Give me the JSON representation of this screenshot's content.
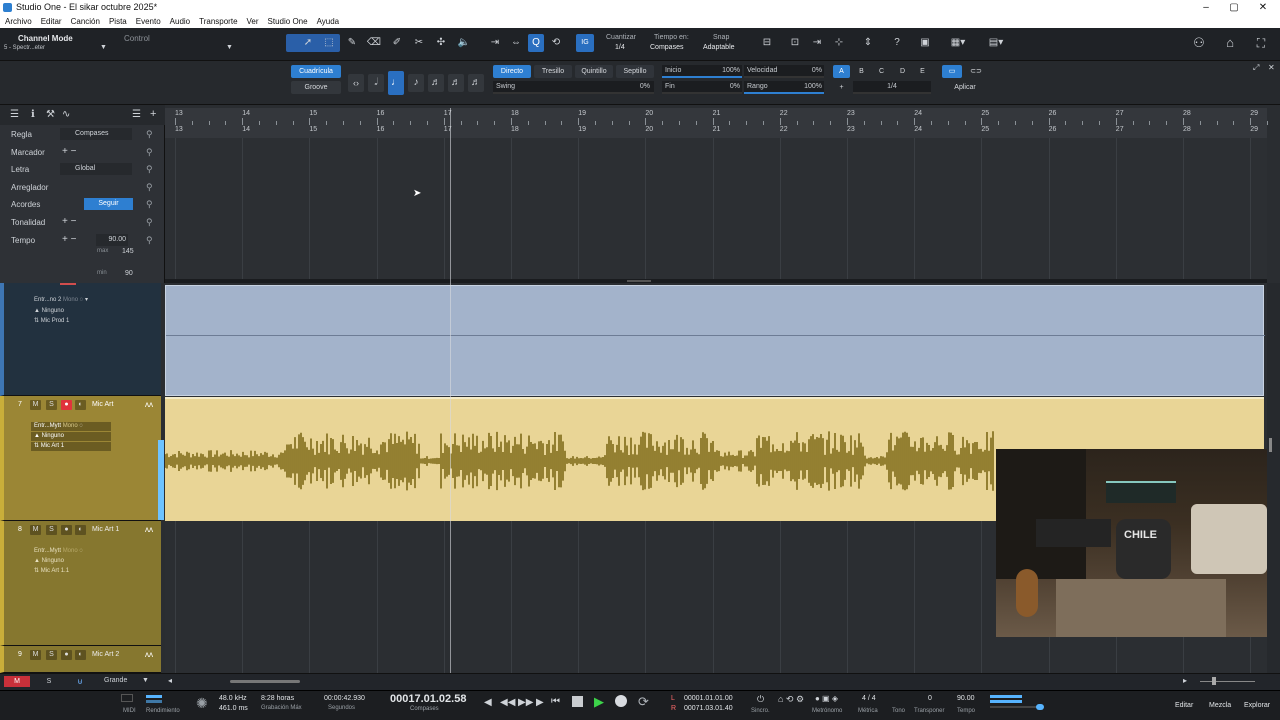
{
  "window": {
    "title": "Studio One - El sikar octubre 2025*",
    "min": "–",
    "max": "▢",
    "close": "✕"
  },
  "menu": [
    "Archivo",
    "Editar",
    "Canción",
    "Pista",
    "Evento",
    "Audio",
    "Transporte",
    "Ver",
    "Studio One",
    "Ayuda"
  ],
  "toolbar": {
    "mode": "Channel Mode",
    "preset": "5 - Spectr...eter",
    "control": "Control",
    "quantize_label": "Cuantizar",
    "quantize_value": "1/4",
    "timebase_label": "Tiempo en:",
    "timebase_value": "Compases",
    "snap_label": "Snap",
    "snap_value": "Adaptable",
    "ig": "IG",
    "help": "?"
  },
  "inspector": {
    "grid_tab": "Cuadrícula",
    "groove_tab": "Groove",
    "modes": [
      "Directo",
      "Tresillo",
      "Quintillo",
      "Septillo"
    ],
    "swing_label": "Swing",
    "swing_value": "0%",
    "inicio_label": "Inicio",
    "inicio_value": "100%",
    "fin_label": "Fin",
    "fin_value": "0%",
    "velocidad_label": "Velocidad",
    "velocidad_value": "0%",
    "rango_label": "Rango",
    "rango_value": "100%",
    "slots": [
      "A",
      "B",
      "C",
      "D",
      "E"
    ],
    "plus": "+",
    "note_value": "1/4",
    "apply": "Aplicar"
  },
  "global_tracks": [
    {
      "name": "Regla",
      "control": "Compases"
    },
    {
      "name": "Marcador",
      "control": "+ −"
    },
    {
      "name": "Letra",
      "control": "Global"
    },
    {
      "name": "Arreglador",
      "control": ""
    },
    {
      "name": "Acordes",
      "control": "Seguir"
    },
    {
      "name": "Tonalidad",
      "control": "+ −"
    },
    {
      "name": "Tempo",
      "control": "+ −",
      "value": "90.00"
    }
  ],
  "tempo_range": {
    "max_label": "max",
    "max": "145",
    "min_label": "min",
    "min": "90"
  },
  "ruler_bars": [
    "13",
    "14",
    "15",
    "16",
    "17",
    "18",
    "19",
    "20",
    "21",
    "22",
    "23",
    "24",
    "25",
    "26",
    "27",
    "28",
    "29"
  ],
  "tracks": [
    {
      "num": "",
      "name": "",
      "input": "Entr...no 2",
      "mono": "Mono",
      "route": "Ninguno",
      "output": "Mic Prod 1"
    },
    {
      "num": "7",
      "name": "Mic Art",
      "input": "Entr...Mytt",
      "mono": "Mono",
      "route": "Ninguno",
      "output": "Mic Art 1"
    },
    {
      "num": "8",
      "name": "Mic Art 1",
      "input": "Entr...Mytt",
      "mono": "Mono",
      "route": "Ninguno",
      "output": "Mic Art 1.1"
    },
    {
      "num": "9",
      "name": "Mic Art 2"
    }
  ],
  "track_buttons": {
    "mute": "M",
    "solo": "S"
  },
  "bottom_left": {
    "m": "M",
    "s": "S",
    "size": "Grande"
  },
  "transport": {
    "midi": "MIDI",
    "render": "Rendimiento",
    "sample_rate": "48.0 kHz",
    "latency": "461.0 ms",
    "rec_time": "8:28 horas",
    "rec_label": "Grabación Máx",
    "seconds_value": "00:00:42.930",
    "seconds_label": "Segundos",
    "position": "00017.01.02.58",
    "position_label": "Compases",
    "left_marker": "00001.01.01.00",
    "right_marker": "00071.03.01.40",
    "l": "L",
    "r": "R",
    "sync": "Sincro.",
    "metronome": "Metrónomo",
    "meter_value": "4 / 4",
    "meter_label": "Métrica",
    "key_label": "Tono",
    "transpose_value": "0",
    "transpose_label": "Transponer",
    "tempo_value": "90.00",
    "tempo_label": "Tempo",
    "edit": "Editar",
    "mix": "Mezcla",
    "browse": "Explorar"
  },
  "webcam_text": "CHILE",
  "colors": {
    "accent": "#2e7fd1",
    "track_blue": "#a3b3cb",
    "track_gold": "#e9d596",
    "wave": "#7e6a18",
    "header_gold": "#9b8635",
    "rec_red": "#e0333c"
  }
}
